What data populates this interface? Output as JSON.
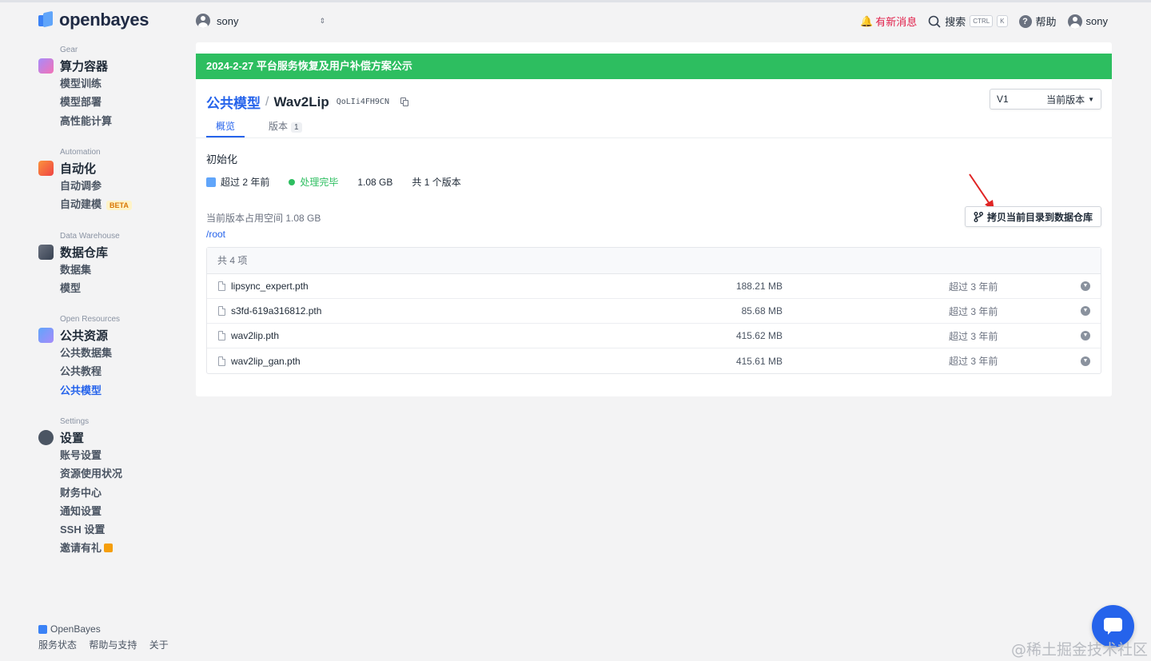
{
  "brand": {
    "name": "openbayes",
    "footer_name": "OpenBayes"
  },
  "sidebar": {
    "groups": [
      {
        "caption": "Gear",
        "title": "算力容器",
        "items": [
          {
            "label": "模型训练"
          },
          {
            "label": "模型部署"
          },
          {
            "label": "高性能计算"
          }
        ]
      },
      {
        "caption": "Automation",
        "title": "自动化",
        "items": [
          {
            "label": "自动调参"
          },
          {
            "label": "自动建模",
            "badge": "BETA"
          }
        ]
      },
      {
        "caption": "Data Warehouse",
        "title": "数据仓库",
        "items": [
          {
            "label": "数据集"
          },
          {
            "label": "模型"
          }
        ]
      },
      {
        "caption": "Open Resources",
        "title": "公共资源",
        "items": [
          {
            "label": "公共数据集"
          },
          {
            "label": "公共教程"
          },
          {
            "label": "公共模型",
            "active": true
          }
        ]
      },
      {
        "caption": "Settings",
        "title": "设置",
        "items": [
          {
            "label": "账号设置"
          },
          {
            "label": "资源使用状况"
          },
          {
            "label": "财务中心"
          },
          {
            "label": "通知设置"
          },
          {
            "label": "SSH 设置"
          },
          {
            "label": "邀请有礼"
          }
        ]
      }
    ],
    "footer_links": [
      "服务状态",
      "帮助与支持",
      "关于"
    ]
  },
  "topbar": {
    "workspace": "sony",
    "notifications": "有新消息",
    "search": "搜索",
    "kbd_ctrl": "CTRL",
    "kbd_k": "K",
    "help": "帮助",
    "user": "sony"
  },
  "banner": "2024-2-27 平台服务恢复及用户补偿方案公示",
  "breadcrumb": {
    "parent": "公共模型",
    "sep": "/",
    "current": "Wav2Lip",
    "id": "QoLIi4FH9CN"
  },
  "version_select": {
    "value": "V1",
    "label": "当前版本"
  },
  "tabs": [
    {
      "label": "概览",
      "active": true
    },
    {
      "label": "版本",
      "count": "1"
    }
  ],
  "description": "初始化",
  "meta": {
    "time": "超过 2 年前",
    "status": "处理完毕",
    "size": "1.08 GB",
    "versions": "共 1 个版本"
  },
  "space": "当前版本占用空间 1.08 GB",
  "path": "/root",
  "copy_button": "拷贝当前目录到数据仓库",
  "table": {
    "header": "共 4 项",
    "rows": [
      {
        "name": "lipsync_expert.pth",
        "size": "188.21 MB",
        "time": "超过 3 年前"
      },
      {
        "name": "s3fd-619a316812.pth",
        "size": "85.68 MB",
        "time": "超过 3 年前"
      },
      {
        "name": "wav2lip.pth",
        "size": "415.62 MB",
        "time": "超过 3 年前"
      },
      {
        "name": "wav2lip_gan.pth",
        "size": "415.61 MB",
        "time": "超过 3 年前"
      }
    ]
  },
  "watermark": "@稀土掘金技术社区",
  "colors": {
    "accent": "#2563eb",
    "banner": "#2dbe60",
    "notification": "#e11d48",
    "arrow": "#e02424"
  }
}
